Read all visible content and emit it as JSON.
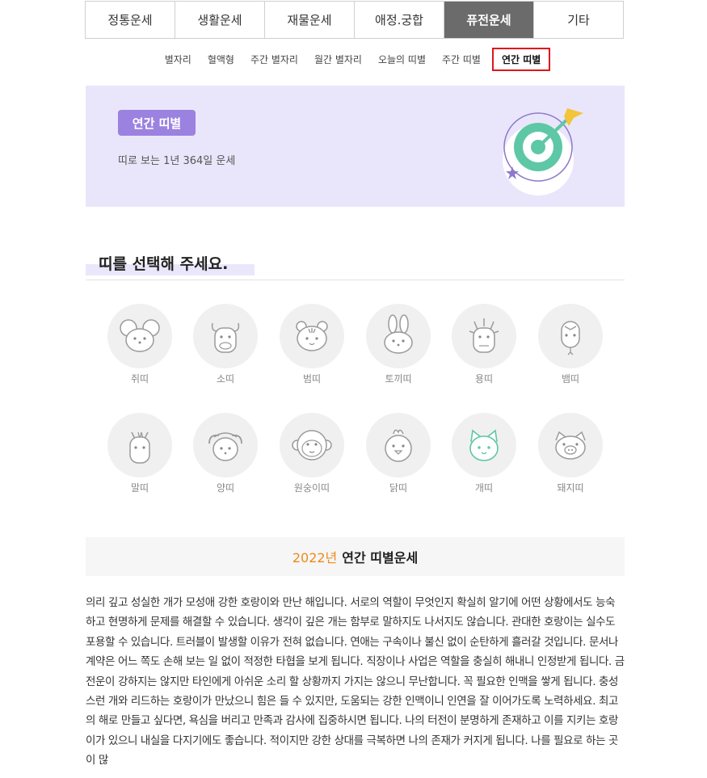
{
  "main_tabs": [
    {
      "label": "정통운세",
      "active": false
    },
    {
      "label": "생활운세",
      "active": false
    },
    {
      "label": "재물운세",
      "active": false
    },
    {
      "label": "애정.궁합",
      "active": false
    },
    {
      "label": "퓨전운세",
      "active": true
    },
    {
      "label": "기타",
      "active": false
    }
  ],
  "sub_tabs": [
    {
      "label": "별자리",
      "active": false
    },
    {
      "label": "혈액형",
      "active": false
    },
    {
      "label": "주간 별자리",
      "active": false
    },
    {
      "label": "월간 별자리",
      "active": false
    },
    {
      "label": "오늘의 띠별",
      "active": false
    },
    {
      "label": "주간 띠별",
      "active": false
    },
    {
      "label": "연간 띠별",
      "active": true
    }
  ],
  "hero": {
    "badge": "연간 띠별",
    "description": "띠로 보는 1년 364일 운세",
    "icon": "target-dart-icon",
    "colors": {
      "bg": "#e9e6fb",
      "badge": "#9b82e0",
      "target": "#5ec7a6",
      "dart": "#f3c53a"
    }
  },
  "section": {
    "title": "띠를 선택해 주세요."
  },
  "zodiac": [
    {
      "label": "쥐띠",
      "icon": "rat-icon",
      "selected": false
    },
    {
      "label": "소띠",
      "icon": "ox-icon",
      "selected": false
    },
    {
      "label": "범띠",
      "icon": "tiger-icon",
      "selected": false
    },
    {
      "label": "토끼띠",
      "icon": "rabbit-icon",
      "selected": false
    },
    {
      "label": "용띠",
      "icon": "dragon-icon",
      "selected": false
    },
    {
      "label": "뱀띠",
      "icon": "snake-icon",
      "selected": false
    },
    {
      "label": "말띠",
      "icon": "horse-icon",
      "selected": false
    },
    {
      "label": "양띠",
      "icon": "sheep-icon",
      "selected": false
    },
    {
      "label": "원숭이띠",
      "icon": "monkey-icon",
      "selected": false
    },
    {
      "label": "닭띠",
      "icon": "rooster-icon",
      "selected": false
    },
    {
      "label": "개띠",
      "icon": "dog-icon",
      "selected": true
    },
    {
      "label": "돼지띠",
      "icon": "pig-icon",
      "selected": false
    }
  ],
  "fortune": {
    "year": "2022년",
    "title": "연간 띠별운세",
    "year_color": "#ee8a1a",
    "body": "의리 깊고 성실한 개가 모성애 강한 호랑이와 만난 해입니다. 서로의 역할이 무엇인지 확실히 알기에 어떤 상황에서도 능숙하고 현명하게 문제를 해결할 수 있습니다. 생각이 깊은 개는 함부로 말하지도 나서지도 않습니다. 관대한 호랑이는 실수도 포용할 수 있습니다. 트러블이 발생할 이유가 전혀 없습니다. 연애는 구속이나 불신 없이 순탄하게 흘러갈 것입니다. 문서나 계약은 어느 쪽도 손해 보는 일 없이 적정한 타협을 보게 됩니다. 직장이나 사업은 역할을 충실히 해내니 인정받게 됩니다. 금전운이 강하지는 않지만 타인에게 아쉬운 소리 할 상황까지 가지는 않으니 무난합니다. 꼭 필요한 인맥을 쌓게 됩니다. 충성스런 개와 리드하는 호랑이가 만났으니 힘은 들 수 있지만, 도움되는 강한 인맥이니 인연을 잘 이어가도록 노력하세요. 최고의 해로 만들고 싶다면, 욕심을 버리고 만족과 감사에 집중하시면 됩니다. 나의 터전이 분명하게 존재하고 이를 지키는 호랑이가 있으니 내실을 다지기에도 좋습니다. 적이지만 강한 상대를 극복하면 나의 존재가 커지게 됩니다. 나를 필요로 하는 곳이 많"
  }
}
